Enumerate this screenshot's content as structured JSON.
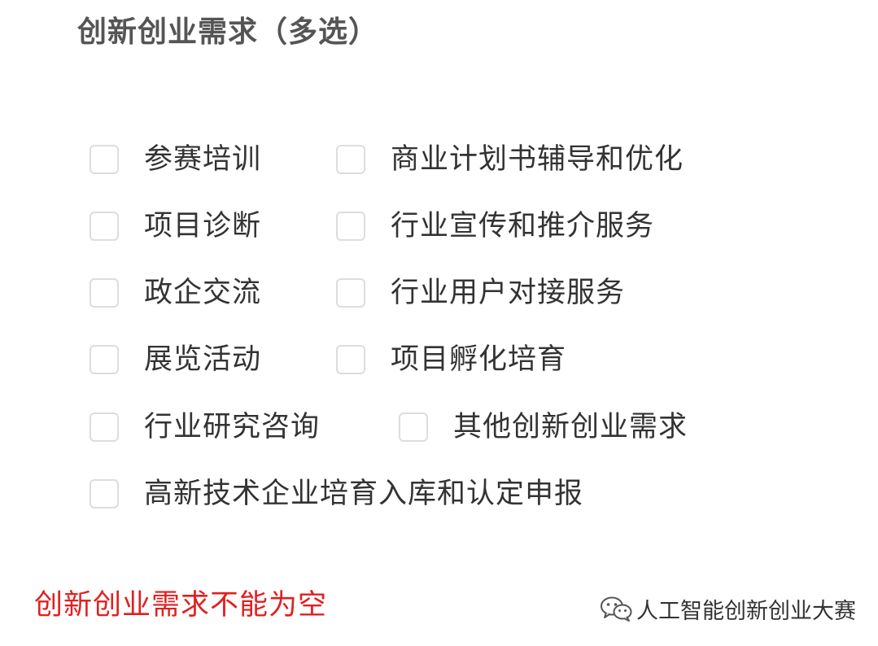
{
  "section": {
    "title": "创新创业需求（多选）"
  },
  "options": {
    "o1": {
      "label": "参赛培训",
      "checked": false
    },
    "o2": {
      "label": "商业计划书辅导和优化",
      "checked": false
    },
    "o3": {
      "label": "项目诊断",
      "checked": false
    },
    "o4": {
      "label": "行业宣传和推介服务",
      "checked": false
    },
    "o5": {
      "label": "政企交流",
      "checked": false
    },
    "o6": {
      "label": "行业用户对接服务",
      "checked": false
    },
    "o7": {
      "label": "展览活动",
      "checked": false
    },
    "o8": {
      "label": "项目孵化培育",
      "checked": false
    },
    "o9": {
      "label": "行业研究咨询",
      "checked": false
    },
    "o10": {
      "label": "其他创新创业需求",
      "checked": false
    },
    "o11": {
      "label": "高新技术企业培育入库和认定申报",
      "checked": false
    }
  },
  "validation": {
    "error_message": "创新创业需求不能为空",
    "error_color": "#e02020"
  },
  "watermark": {
    "icon": "wechat-icon",
    "text": "人工智能创新创业大赛"
  }
}
